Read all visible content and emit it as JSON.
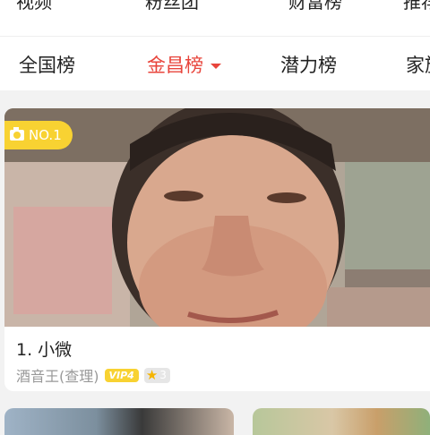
{
  "top_strip": {
    "items": [
      "视频",
      "粉丝团",
      "财富榜",
      "推荐"
    ]
  },
  "tabs": [
    {
      "label": "全国榜",
      "active": false
    },
    {
      "label": "金昌榜",
      "active": true,
      "has_dropdown": true
    },
    {
      "label": "潜力榜",
      "active": false
    },
    {
      "label": "家族榜",
      "active": false
    }
  ],
  "colors": {
    "accent": "#e8453c",
    "badge": "#f8d232"
  },
  "entry": {
    "rank_badge": "NO.1",
    "name": "1. 小微",
    "title": "酒音王(查理)",
    "vip": "VIP4",
    "star_level": "3"
  }
}
